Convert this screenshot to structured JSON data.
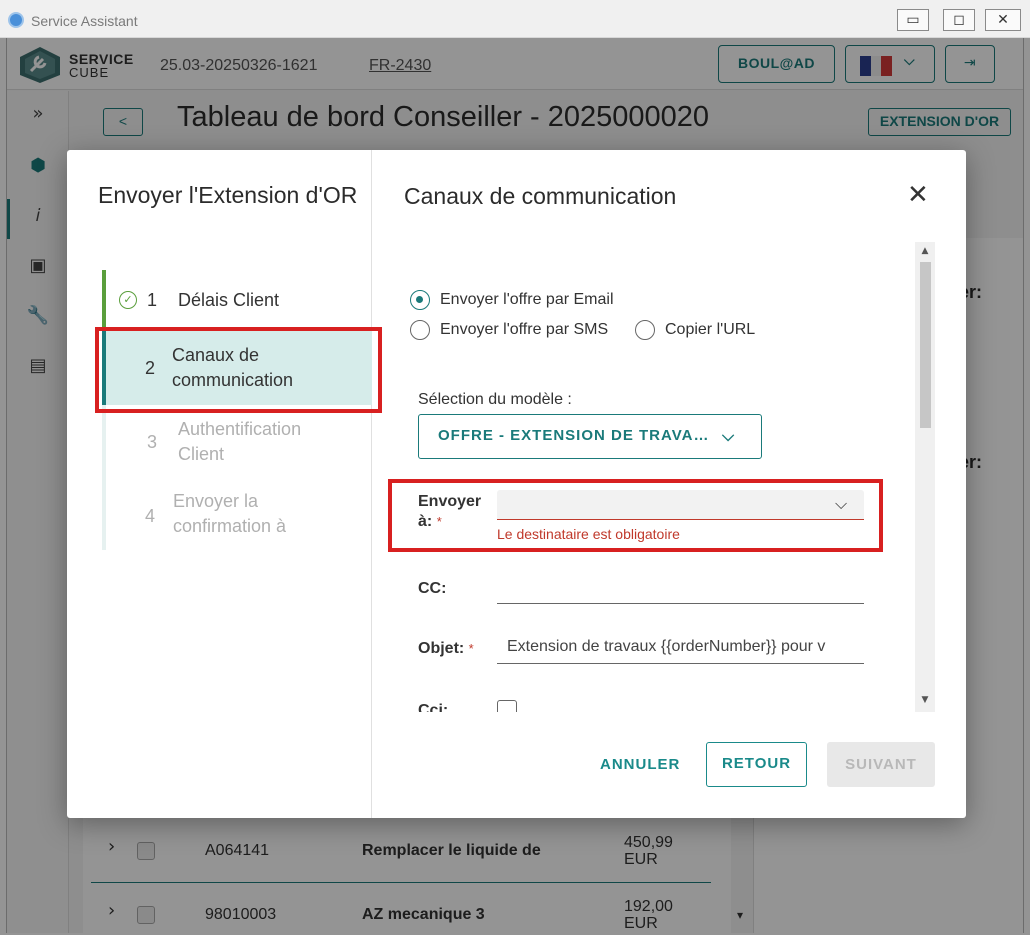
{
  "window": {
    "title": "Service Assistant",
    "minimize": "▭",
    "maximize": "◻",
    "close": "✕"
  },
  "header": {
    "logo_line1": "SERVICE",
    "logo_line2": "CUBE",
    "session_id": "25.03-20250326-1621",
    "site_link": "FR-2430",
    "user_button": "BOUL@AD",
    "flag_colors": [
      "#2b3f8f",
      "#f2f2f2",
      "#d23a3a"
    ],
    "dropdown_chevron": "⌵",
    "logout_icon": "⇥"
  },
  "rail": {
    "expand_icon": "»",
    "items": [
      "cube-edit-icon",
      "info-icon",
      "briefcase-icon",
      "wrench-icon",
      "inbox-icon"
    ],
    "glyphs": [
      "⬢",
      "𝑖",
      "▣",
      "🔧",
      "▤"
    ]
  },
  "page": {
    "back_label": "<",
    "title": "Tableau de bord Conseiller - 2025000020",
    "extension_button": "EXTENSION D'OR",
    "right_label_1": "ier:",
    "right_label_2": "ier:"
  },
  "table": {
    "rows": [
      {
        "code": "A064141",
        "description": "Remplacer le liquide de",
        "amount_1": "450,99",
        "amount_2": "EUR"
      },
      {
        "code": "98010003",
        "description": "AZ mecanique 3",
        "amount_1": "192,00",
        "amount_2": "EUR"
      }
    ],
    "expand_glyph": "›",
    "down_glyph": "▾"
  },
  "modal": {
    "heading": "Envoyer l'Extension d'OR",
    "steps": [
      {
        "number": "1",
        "label": "Délais Client",
        "state": "done"
      },
      {
        "number": "2",
        "label": "Canaux de communication",
        "state": "active"
      },
      {
        "number": "3",
        "label": "Authentification Client",
        "state": "pending"
      },
      {
        "number": "4",
        "label": "Envoyer la confirmation à",
        "state": "pending"
      }
    ],
    "check_glyph": "✓",
    "panel_title": "Canaux de communication",
    "close_glyph": "✕",
    "channels": {
      "email": "Envoyer l'offre par Email",
      "sms": "Envoyer l'offre par SMS",
      "url": "Copier l'URL",
      "selected": "email"
    },
    "template": {
      "label": "Sélection du modèle :",
      "value": "OFFRE - EXTENSION DE TRAVA…",
      "chevron": "⌵"
    },
    "send_to": {
      "label_line1": "Envoyer",
      "label_line2": "à:",
      "required": "*",
      "value": "",
      "error": "Le destinataire est obligatoire",
      "chevron": "⌵"
    },
    "cc": {
      "label": "CC:",
      "value": ""
    },
    "subject": {
      "label": "Objet:",
      "required": "*",
      "value": "Extension de travaux {{orderNumber}} pour v"
    },
    "bcc": {
      "label": "Cci:"
    },
    "scroll_up": "▲",
    "scroll_down": "▼",
    "buttons": {
      "cancel": "ANNULER",
      "back": "RETOUR",
      "next": "SUIVANT"
    },
    "accent_color": "#1a7a7a",
    "error_color": "#c0392b"
  }
}
